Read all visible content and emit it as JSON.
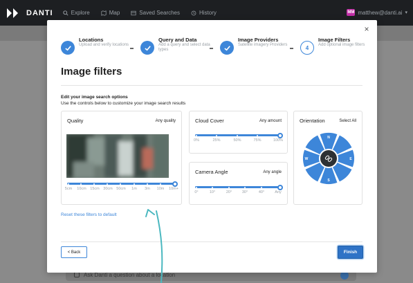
{
  "app": {
    "brand": "DANTI",
    "nav": [
      {
        "label": "Explore",
        "icon": "search-icon"
      },
      {
        "label": "Map",
        "icon": "map-icon"
      },
      {
        "label": "Saved Searches",
        "icon": "saved-searches-icon"
      },
      {
        "label": "History",
        "icon": "history-icon"
      }
    ],
    "user": {
      "initials": "MM",
      "email": "matthew@danti.ai"
    }
  },
  "background": {
    "ask_placeholder": "Ask Danti a question about a location"
  },
  "modal": {
    "close": "×",
    "steps": [
      {
        "title": "Locations",
        "subtitle": "Upload and verify locations",
        "state": "complete"
      },
      {
        "title": "Query and Data",
        "subtitle": "Add a query and select data types",
        "state": "complete"
      },
      {
        "title": "Image Providers",
        "subtitle": "Satellite imagery Providers",
        "state": "complete"
      },
      {
        "title": "Image Filters",
        "subtitle": "Add optional image filters",
        "state": "current",
        "number": "4"
      }
    ],
    "title": "Image filters",
    "section_title": "Edit your image search options",
    "section_subtitle": "Use the controls below to customize your image search results",
    "quality": {
      "title": "Quality",
      "value": "Any quality",
      "ticks": [
        "5cm",
        "10cm",
        "15cm",
        "30cm",
        "50cm",
        "1m",
        "3m",
        "10m",
        "10m+"
      ]
    },
    "cloud_cover": {
      "title": "Cloud Cover",
      "value": "Any amount",
      "ticks": [
        "0%",
        "25%",
        "50%",
        "75%",
        "100%"
      ]
    },
    "camera_angle": {
      "title": "Camera Angle",
      "value": "Any angle",
      "ticks": [
        "0°",
        "10°",
        "20°",
        "30°",
        "40°",
        "Any"
      ]
    },
    "orientation": {
      "title": "Orientation",
      "select_all": "Select All",
      "directions": [
        "N",
        "E",
        "S",
        "W"
      ]
    },
    "reset": "Reset these filters to default",
    "back": "< Back",
    "finish": "Finish"
  },
  "colors": {
    "accent": "#3d86d9",
    "topbar": "#1d1f22",
    "annotation": "#4bb8c0"
  }
}
